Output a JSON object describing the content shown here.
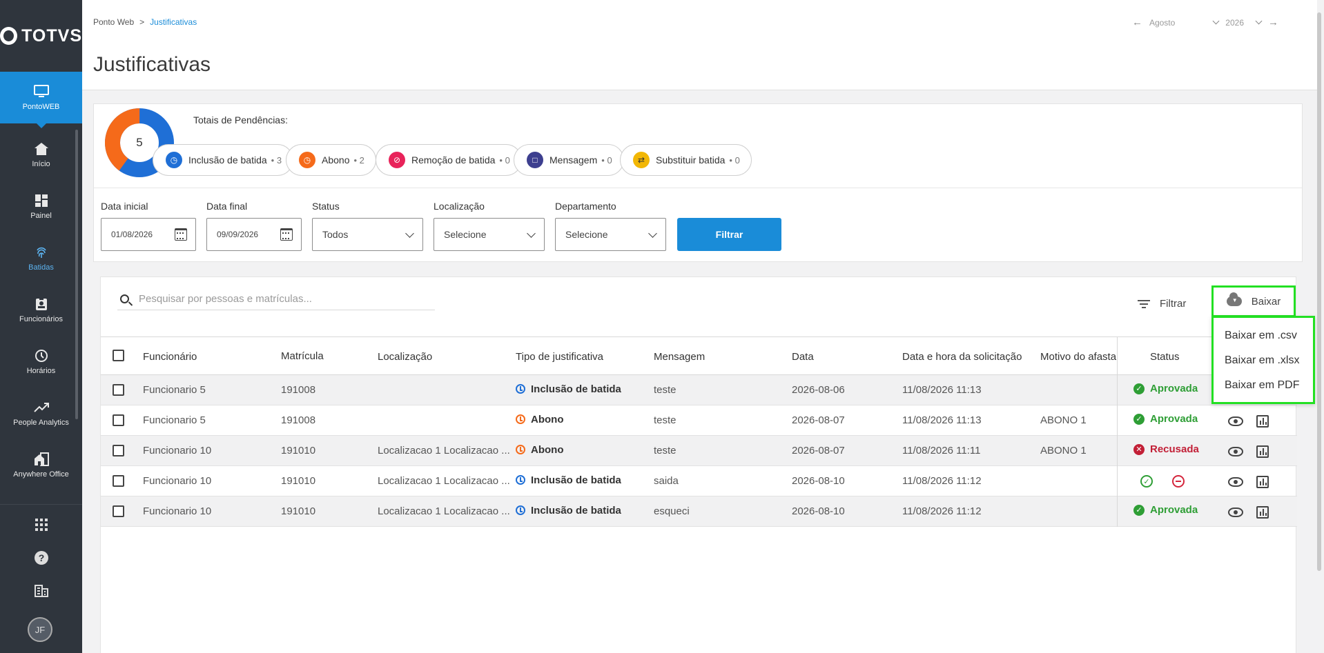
{
  "sidebar": {
    "logo": "TOTVS",
    "items": [
      {
        "label": "PontoWEB",
        "icon": "monitor-icon"
      },
      {
        "label": "Início",
        "icon": "home-icon"
      },
      {
        "label": "Painel",
        "icon": "dashboard-icon"
      },
      {
        "label": "Batidas",
        "icon": "fingerprint-icon"
      },
      {
        "label": "Funcionários",
        "icon": "badge-icon"
      },
      {
        "label": "Horários",
        "icon": "clock-icon"
      },
      {
        "label": "People Analytics",
        "icon": "trending-up-icon"
      },
      {
        "label": "Anywhere Office",
        "icon": "home-work-icon"
      }
    ],
    "bottom": [
      "apps-icon",
      "help-icon",
      "building-icon"
    ],
    "avatar": "JF"
  },
  "header": {
    "breadcrumb": [
      "Ponto Web",
      "Justificativas"
    ],
    "breadcrumb_sep": ">",
    "title": "Justificativas",
    "month": "Agosto",
    "year": "2026"
  },
  "summary": {
    "total": "5",
    "title": "Totais de Pendências:",
    "donut": {
      "orange_fraction": 0.4,
      "blue_fraction": 0.6,
      "colors": {
        "blue": "#1f6fd6",
        "orange": "#f56a1a"
      }
    },
    "chips": [
      {
        "label": "Inclusão de batida",
        "count": "3",
        "color": "#1f6fd6"
      },
      {
        "label": "Abono",
        "count": "2",
        "color": "#f56a1a"
      },
      {
        "label": "Remoção de batida",
        "count": "0",
        "color": "#e8235a"
      },
      {
        "label": "Mensagem",
        "count": "0",
        "color": "#3d3f8f"
      },
      {
        "label": "Substituir batida",
        "count": "0",
        "color": "#f2b705"
      }
    ],
    "filters": {
      "start_label": "Data inicial",
      "start_value": "01/08/2026",
      "end_label": "Data final",
      "end_value": "09/09/2026",
      "status_label": "Status",
      "status_value": "Todos",
      "location_label": "Localização",
      "location_value": "Selecione",
      "dept_label": "Departamento",
      "dept_value": "Selecione",
      "button": "Filtrar"
    }
  },
  "table": {
    "search_placeholder": "Pesquisar por pessoas e matrículas...",
    "filter_label": "Filtrar",
    "download_label": "Baixar",
    "download_menu": [
      "Baixar em .csv",
      "Baixar em .xlsx",
      "Baixar em PDF"
    ],
    "columns": [
      "Funcionário",
      "Matrícula",
      "Localização",
      "Tipo de justificativa",
      "Mensagem",
      "Data",
      "Data e hora da solicitação",
      "Motivo do afasta",
      "Status"
    ],
    "rows": [
      {
        "name": "Funcionario 5",
        "id": "191008",
        "location": "",
        "type": "Inclusão de batida",
        "type_color": "#1f6fd6",
        "message": "teste",
        "date": "2026-08-06",
        "requested": "11/08/2026 11:13",
        "reason": "",
        "status": "Aprovada",
        "status_color": "#2e9e35"
      },
      {
        "name": "Funcionario 5",
        "id": "191008",
        "location": "",
        "type": "Abono",
        "type_color": "#f56a1a",
        "message": "teste",
        "date": "2026-08-07",
        "requested": "11/08/2026 11:13",
        "reason": "ABONO 1",
        "status": "Aprovada",
        "status_color": "#2e9e35"
      },
      {
        "name": "Funcionario 10",
        "id": "191010",
        "location": "Localizacao 1 Localizacao ...",
        "type": "Abono",
        "type_color": "#f56a1a",
        "message": "teste",
        "date": "2026-08-07",
        "requested": "11/08/2026 11:11",
        "reason": "ABONO 1",
        "status": "Recusada",
        "status_color": "#c21f36"
      },
      {
        "name": "Funcionario 10",
        "id": "191010",
        "location": "Localizacao 1 Localizacao ...",
        "type": "Inclusão de batida",
        "type_color": "#1f6fd6",
        "message": "saida",
        "date": "2026-08-10",
        "requested": "11/08/2026 11:12",
        "reason": "",
        "status": "",
        "status_color": ""
      },
      {
        "name": "Funcionario 10",
        "id": "191010",
        "location": "Localizacao 1 Localizacao ...",
        "type": "Inclusão de batida",
        "type_color": "#1f6fd6",
        "message": "esqueci",
        "date": "2026-08-10",
        "requested": "11/08/2026 11:12",
        "reason": "",
        "status": "Aprovada",
        "status_color": "#2e9e35"
      }
    ]
  }
}
